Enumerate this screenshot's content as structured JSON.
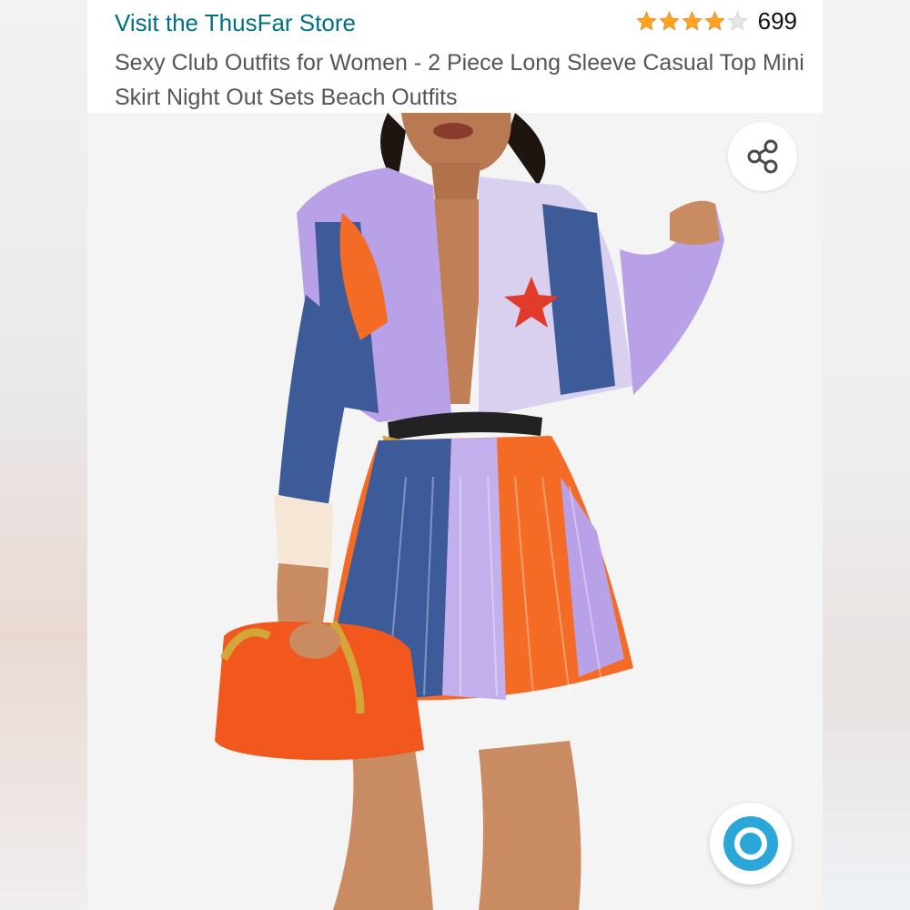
{
  "header": {
    "store_link": "Visit the ThusFar Store",
    "rating": {
      "stars": 4,
      "max_stars": 5,
      "count": "699"
    },
    "title": "Sexy Club Outfits for Women - 2 Piece Long Sleeve Casual Top Mini Skirt Night Out Sets Beach Outfits"
  },
  "image": {
    "description_icon": "product-photo",
    "share_icon": "share-icon",
    "assistant_icon": "alexa-icon"
  },
  "colors": {
    "link": "#007185",
    "star_filled": "#ffa41c",
    "star_empty": "#d5d9d9",
    "bag": "#f2581e",
    "alexa": "#2aa7d8"
  }
}
